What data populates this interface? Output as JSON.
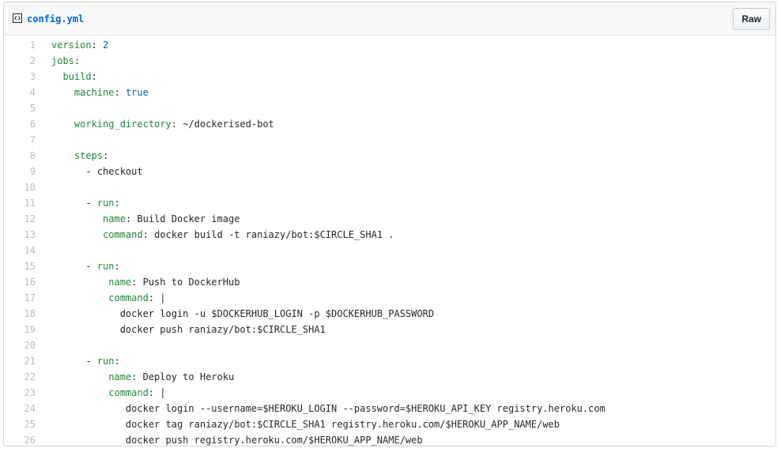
{
  "file": {
    "name": "config.yml",
    "raw_label": "Raw",
    "icon": "file-code-icon"
  },
  "colors": {
    "key": "#22863a",
    "constant": "#005cc5",
    "text": "#24292e",
    "link": "#0366d6"
  },
  "lines": [
    {
      "num": "1",
      "indent": "",
      "key": "version",
      "sep": ": ",
      "val": "2",
      "val_type": "const"
    },
    {
      "num": "2",
      "indent": "",
      "key": "jobs",
      "sep": ":",
      "val": "",
      "val_type": "plain"
    },
    {
      "num": "3",
      "indent": "  ",
      "key": "build",
      "sep": ":",
      "val": "",
      "val_type": "plain"
    },
    {
      "num": "4",
      "indent": "    ",
      "key": "machine",
      "sep": ": ",
      "val": "true",
      "val_type": "const"
    },
    {
      "num": "5",
      "indent": "",
      "key": "",
      "sep": "",
      "val": "",
      "val_type": "plain"
    },
    {
      "num": "6",
      "indent": "    ",
      "key": "working_directory",
      "sep": ": ",
      "val": "~/dockerised-bot",
      "val_type": "plain"
    },
    {
      "num": "7",
      "indent": "",
      "key": "",
      "sep": "",
      "val": "",
      "val_type": "plain"
    },
    {
      "num": "8",
      "indent": "    ",
      "key": "steps",
      "sep": ":",
      "val": "",
      "val_type": "plain"
    },
    {
      "num": "9",
      "indent": "      - ",
      "key": "",
      "sep": "",
      "val": "checkout",
      "val_type": "plain"
    },
    {
      "num": "10",
      "indent": "",
      "key": "",
      "sep": "",
      "val": "",
      "val_type": "plain"
    },
    {
      "num": "11",
      "indent": "      - ",
      "key": "run",
      "sep": ":",
      "val": "",
      "val_type": "plain"
    },
    {
      "num": "12",
      "indent": "         ",
      "key": "name",
      "sep": ": ",
      "val": "Build Docker image",
      "val_type": "plain"
    },
    {
      "num": "13",
      "indent": "         ",
      "key": "command",
      "sep": ": ",
      "val": "docker build -t raniazy/bot:$CIRCLE_SHA1 .",
      "val_type": "plain"
    },
    {
      "num": "14",
      "indent": "",
      "key": "",
      "sep": "",
      "val": "",
      "val_type": "plain"
    },
    {
      "num": "15",
      "indent": "      - ",
      "key": "run",
      "sep": ":",
      "val": "",
      "val_type": "plain"
    },
    {
      "num": "16",
      "indent": "          ",
      "key": "name",
      "sep": ": ",
      "val": "Push to DockerHub",
      "val_type": "plain"
    },
    {
      "num": "17",
      "indent": "          ",
      "key": "command",
      "sep": ": ",
      "val": "|",
      "val_type": "plain"
    },
    {
      "num": "18",
      "indent": "            ",
      "key": "",
      "sep": "",
      "val": "docker login -u $DOCKERHUB_LOGIN -p $DOCKERHUB_PASSWORD",
      "val_type": "plain"
    },
    {
      "num": "19",
      "indent": "            ",
      "key": "",
      "sep": "",
      "val": "docker push raniazy/bot:$CIRCLE_SHA1",
      "val_type": "plain"
    },
    {
      "num": "20",
      "indent": "",
      "key": "",
      "sep": "",
      "val": "",
      "val_type": "plain"
    },
    {
      "num": "21",
      "indent": "      - ",
      "key": "run",
      "sep": ":",
      "val": "",
      "val_type": "plain"
    },
    {
      "num": "22",
      "indent": "          ",
      "key": "name",
      "sep": ": ",
      "val": "Deploy to Heroku",
      "val_type": "plain"
    },
    {
      "num": "23",
      "indent": "          ",
      "key": "command",
      "sep": ": ",
      "val": "|",
      "val_type": "plain"
    },
    {
      "num": "24",
      "indent": "             ",
      "key": "",
      "sep": "",
      "val": "docker login --username=$HEROKU_LOGIN --password=$HEROKU_API_KEY registry.heroku.com",
      "val_type": "plain"
    },
    {
      "num": "25",
      "indent": "             ",
      "key": "",
      "sep": "",
      "val": "docker tag raniazy/bot:$CIRCLE_SHA1 registry.heroku.com/$HEROKU_APP_NAME/web",
      "val_type": "plain"
    },
    {
      "num": "26",
      "indent": "             ",
      "key": "",
      "sep": "",
      "val": "docker push registry.heroku.com/$HEROKU_APP_NAME/web",
      "val_type": "plain"
    }
  ]
}
